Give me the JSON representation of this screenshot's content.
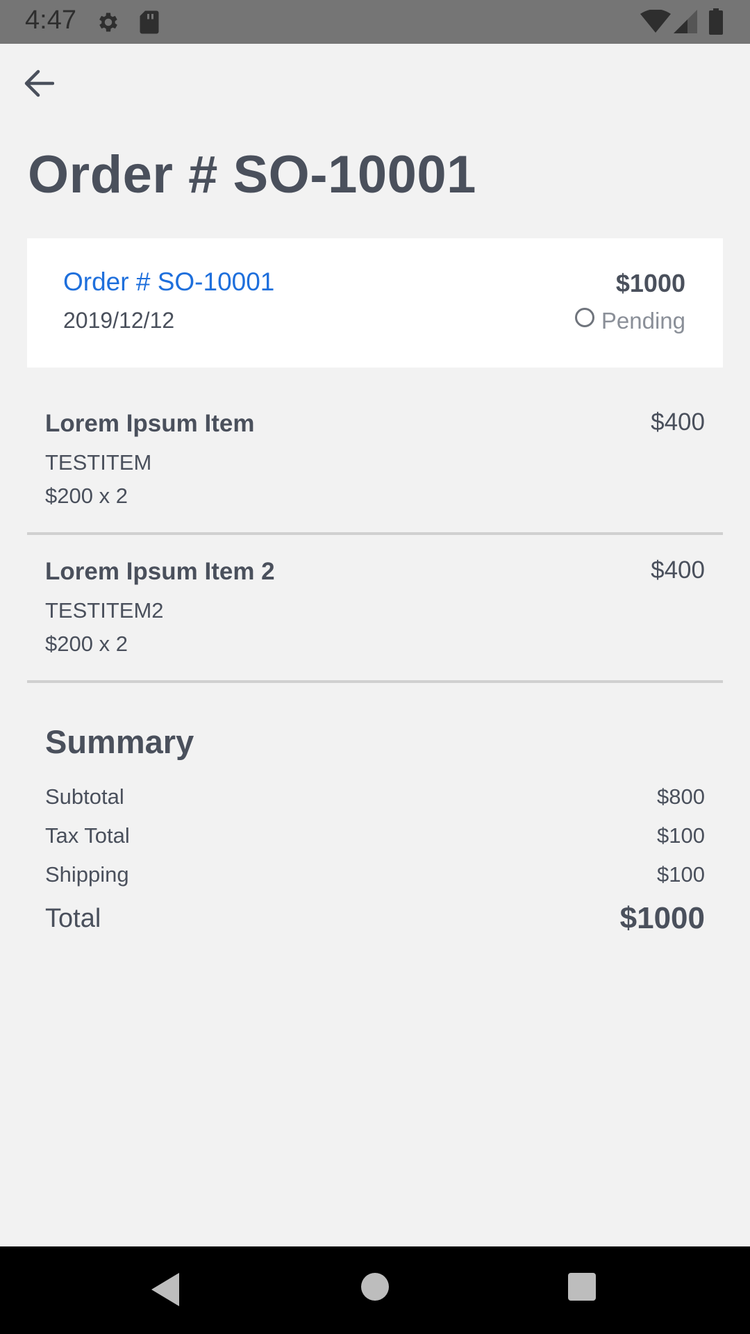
{
  "status_bar": {
    "time": "4:47",
    "icons": [
      "gear-icon",
      "sd-card-icon",
      "wifi-icon",
      "cell-signal-icon",
      "battery-icon"
    ]
  },
  "page": {
    "title": "Order # SO-10001"
  },
  "order_card": {
    "order_link": "Order # SO-10001",
    "date": "2019/12/12",
    "amount": "$1000",
    "status": "Pending"
  },
  "line_items": [
    {
      "name": "Lorem Ipsum Item",
      "sku": "TESTITEM",
      "qty": "$200 x 2",
      "price": "$400"
    },
    {
      "name": "Lorem Ipsum Item 2",
      "sku": "TESTITEM2",
      "qty": "$200 x 2",
      "price": "$400"
    }
  ],
  "summary": {
    "title": "Summary",
    "rows": [
      {
        "label": "Subtotal",
        "value": "$800"
      },
      {
        "label": "Tax Total",
        "value": "$100"
      },
      {
        "label": "Shipping",
        "value": "$100"
      }
    ],
    "total_label": "Total",
    "total_value": "$1000"
  },
  "colors": {
    "background": "#f2f2f2",
    "text": "#4a505c",
    "link": "#1e6fdc",
    "status_muted": "#8a8f98",
    "divider": "#d0d0d0"
  }
}
